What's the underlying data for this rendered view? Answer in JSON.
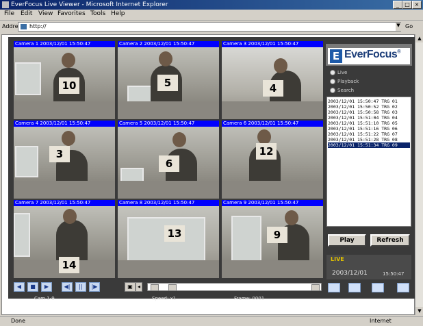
{
  "window": {
    "title": "EverFocus Live Viewer - Microsoft Internet Explorer"
  },
  "menu": [
    "File",
    "Edit",
    "View",
    "Favorites",
    "Tools",
    "Help"
  ],
  "address": {
    "label": "Address",
    "url": "http://",
    "go_label": "Go"
  },
  "cameras": [
    {
      "header": "Camera 1  2003/12/01  15:50:47",
      "number": "10"
    },
    {
      "header": "Camera 2  2003/12/01  15:50:47",
      "number": "5"
    },
    {
      "header": "Camera 3  2003/12/01  15:50:47",
      "number": "4"
    },
    {
      "header": "Camera 4  2003/12/01  15:50:47",
      "number": "3"
    },
    {
      "header": "Camera 5  2003/12/01  15:50:47",
      "number": "6"
    },
    {
      "header": "Camera 6  2003/12/01  15:50:47",
      "number": "12"
    },
    {
      "header": "Camera 7  2003/12/01  15:50:47",
      "number": "14"
    },
    {
      "header": "Camera 8  2003/12/01  15:50:47",
      "number": "13"
    },
    {
      "header": "Camera 9  2003/12/01  15:50:47",
      "number": "9"
    }
  ],
  "logo": {
    "mark": "E",
    "text": "EverFocus",
    "reg": "®"
  },
  "modes": [
    "Live",
    "Playback",
    "Search"
  ],
  "log": [
    "2003/12/01  15:50:47  TRG 01",
    "2003/12/01  15:50:52  TRG 02",
    "2003/12/01  15:50:58  TRG 03",
    "2003/12/01  15:51:04  TRG 04",
    "2003/12/01  15:51:10  TRG 05",
    "2003/12/01  15:51:16  TRG 06",
    "2003/12/01  15:51:22  TRG 07",
    "2003/12/01  15:51:28  TRG 08",
    "2003/12/01  15:51:34  TRG 09"
  ],
  "log_selected": 8,
  "buttons": {
    "play": "Play",
    "refresh": "Refresh"
  },
  "status": {
    "mode": "LIVE",
    "date": "2003/12/01",
    "time": "15:50:47"
  },
  "controls": [
    "◀",
    "■",
    "▶",
    "◀|",
    "||",
    "|▶"
  ],
  "info": {
    "left": "Cam 1-9",
    "mid": "Speed: x1",
    "right": "Frame: 0001"
  },
  "statusbar": {
    "left": "Done",
    "right": "Internet"
  },
  "colors": {
    "camera_header": "#0000ff",
    "app_bg": "#3a3a3a",
    "log_select": "#0a246a"
  }
}
